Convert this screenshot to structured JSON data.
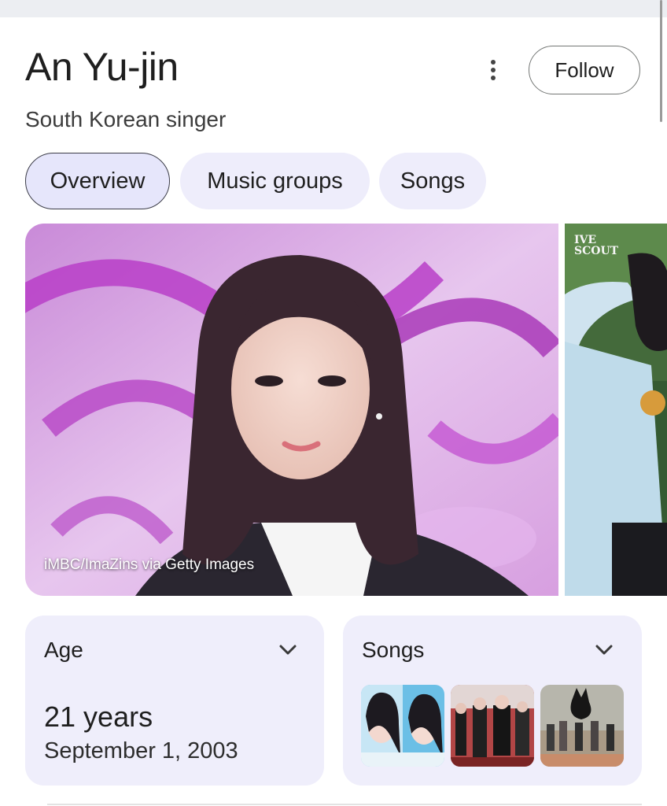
{
  "entity": {
    "name": "An Yu-jin",
    "description": "South Korean singer"
  },
  "actions": {
    "more_icon": "more-vert-icon",
    "follow_label": "Follow"
  },
  "tabs": [
    {
      "label": "Overview",
      "active": true
    },
    {
      "label": "Music groups",
      "active": false
    },
    {
      "label": "Songs",
      "active": false
    }
  ],
  "media": {
    "credit": "iMBC/ImaZins via Getty Images",
    "second_image_text": "IVE SCOUT"
  },
  "cards": {
    "age": {
      "title": "Age",
      "value": "21 years",
      "date": "September 1, 2003"
    },
    "songs": {
      "title": "Songs",
      "thumbnails": [
        "song-thumbnail-1",
        "song-thumbnail-2",
        "song-thumbnail-3"
      ]
    }
  },
  "colors": {
    "chip_bg": "#eeedfb",
    "card_bg": "#efeefb",
    "accent_border": "#3c3d48"
  }
}
